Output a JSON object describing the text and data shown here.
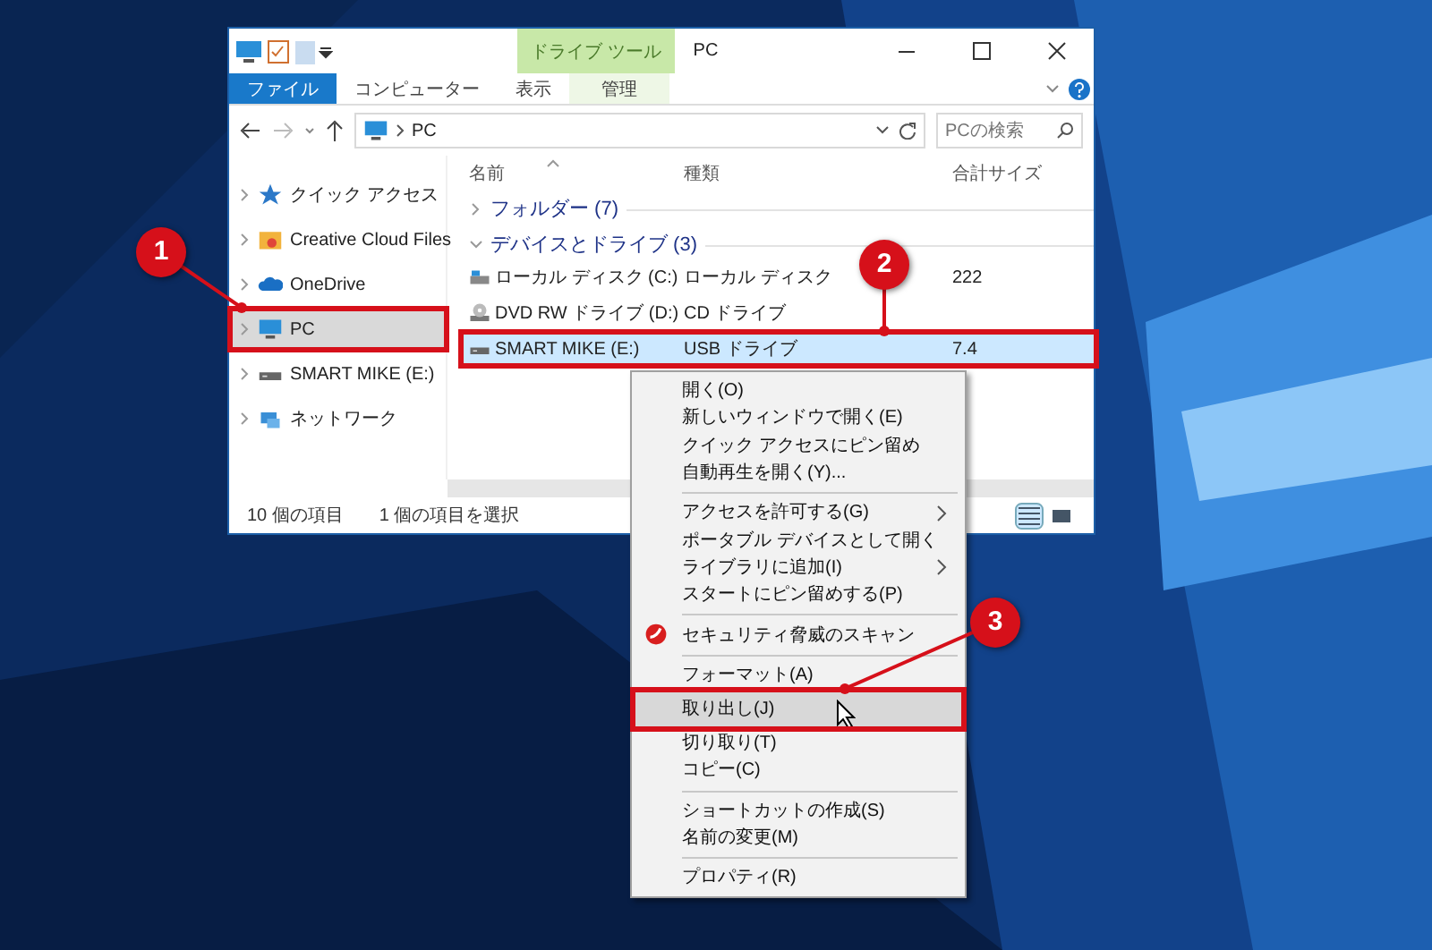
{
  "window": {
    "title": "PC",
    "context_tab": "ドライブ ツール",
    "ribbon_tabs": [
      {
        "label": "ファイル",
        "kind": "file",
        "selected": false
      },
      {
        "label": "コンピューター",
        "kind": "tab",
        "selected": false
      },
      {
        "label": "表示",
        "kind": "tab",
        "selected": false
      },
      {
        "label": "管理",
        "kind": "context",
        "selected": false
      }
    ]
  },
  "address": {
    "path": "PC",
    "search_placeholder": "PCの検索"
  },
  "nav": [
    {
      "label": "クイック アクセス",
      "selected": false
    },
    {
      "label": "Creative Cloud Files",
      "selected": false
    },
    {
      "label": "OneDrive",
      "selected": false
    },
    {
      "label": "PC",
      "selected": true
    },
    {
      "label": "SMART MIKE (E:)",
      "selected": false
    },
    {
      "label": "ネットワーク",
      "selected": false
    }
  ],
  "columns": [
    "名前",
    "種類",
    "合計サイズ"
  ],
  "groups": [
    {
      "label": "フォルダー (7)",
      "expanded": false
    },
    {
      "label": "デバイスとドライブ (3)",
      "expanded": true,
      "rows": [
        {
          "name": "ローカル ディスク (C:)",
          "type": "ローカル ディスク",
          "size": "222",
          "selected": false
        },
        {
          "name": "DVD RW ドライブ (D:)",
          "type": "CD ドライブ",
          "selected": false
        },
        {
          "name": "SMART MIKE (E:)",
          "type": "USB ドライブ",
          "size": "7.4",
          "selected": true
        }
      ]
    }
  ],
  "status_bar": {
    "count": "10 個の項目",
    "selection": "1 個の項目を選択",
    "views": [
      {
        "kind": "details",
        "selected": true
      },
      {
        "kind": "tiles",
        "selected": false
      }
    ]
  },
  "context_menu": [
    {
      "kind": "item",
      "label": "開く(O)",
      "selected": false,
      "submenu": false
    },
    {
      "kind": "item",
      "label": "新しいウィンドウで開く(E)",
      "selected": false,
      "submenu": false
    },
    {
      "kind": "item",
      "label": "クイック アクセスにピン留め",
      "selected": false,
      "submenu": false
    },
    {
      "kind": "item",
      "label": "自動再生を開く(Y)...",
      "selected": false,
      "submenu": false
    },
    {
      "kind": "separator"
    },
    {
      "kind": "item",
      "label": "アクセスを許可する(G)",
      "selected": false,
      "submenu": true
    },
    {
      "kind": "item",
      "label": "ポータブル デバイスとして開く",
      "selected": false,
      "submenu": false
    },
    {
      "kind": "item",
      "label": "ライブラリに追加(I)",
      "selected": false,
      "submenu": true
    },
    {
      "kind": "item",
      "label": "スタートにピン留めする(P)",
      "selected": false,
      "submenu": false
    },
    {
      "kind": "separator"
    },
    {
      "kind": "scan",
      "label": "セキュリティ脅威のスキャン",
      "selected": false,
      "submenu": false
    },
    {
      "kind": "separator"
    },
    {
      "kind": "item",
      "label": "フォーマット(A)",
      "selected": false,
      "submenu": false
    },
    {
      "kind": "item",
      "label": "取り出し(J)",
      "selected": true,
      "submenu": false
    },
    {
      "kind": "item",
      "label": "切り取り(T)",
      "selected": false,
      "submenu": false
    },
    {
      "kind": "item",
      "label": "コピー(C)",
      "selected": false,
      "submenu": false
    },
    {
      "kind": "separator"
    },
    {
      "kind": "item",
      "label": "ショートカットの作成(S)",
      "selected": false,
      "submenu": false
    },
    {
      "kind": "item",
      "label": "名前の変更(M)",
      "selected": false,
      "submenu": false
    },
    {
      "kind": "separator"
    },
    {
      "kind": "item",
      "label": "プロパティ(R)",
      "selected": false,
      "submenu": false
    }
  ],
  "annotations": [
    {
      "number": "1"
    },
    {
      "number": "2"
    },
    {
      "number": "3"
    }
  ]
}
